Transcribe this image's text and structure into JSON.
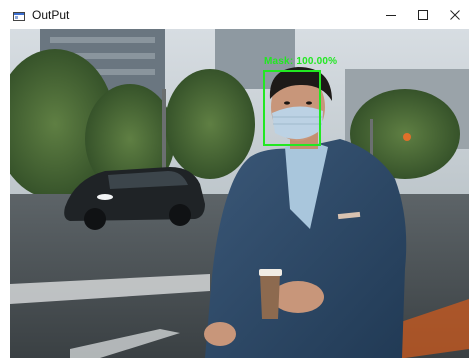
{
  "window": {
    "title": "OutPut",
    "app_icon": "window-app-icon",
    "controls": {
      "minimize": "minimize-icon",
      "maximize": "maximize-icon",
      "close": "close-icon"
    }
  },
  "detection": {
    "label": "Mask: 100.00%",
    "color": "#22e822"
  }
}
